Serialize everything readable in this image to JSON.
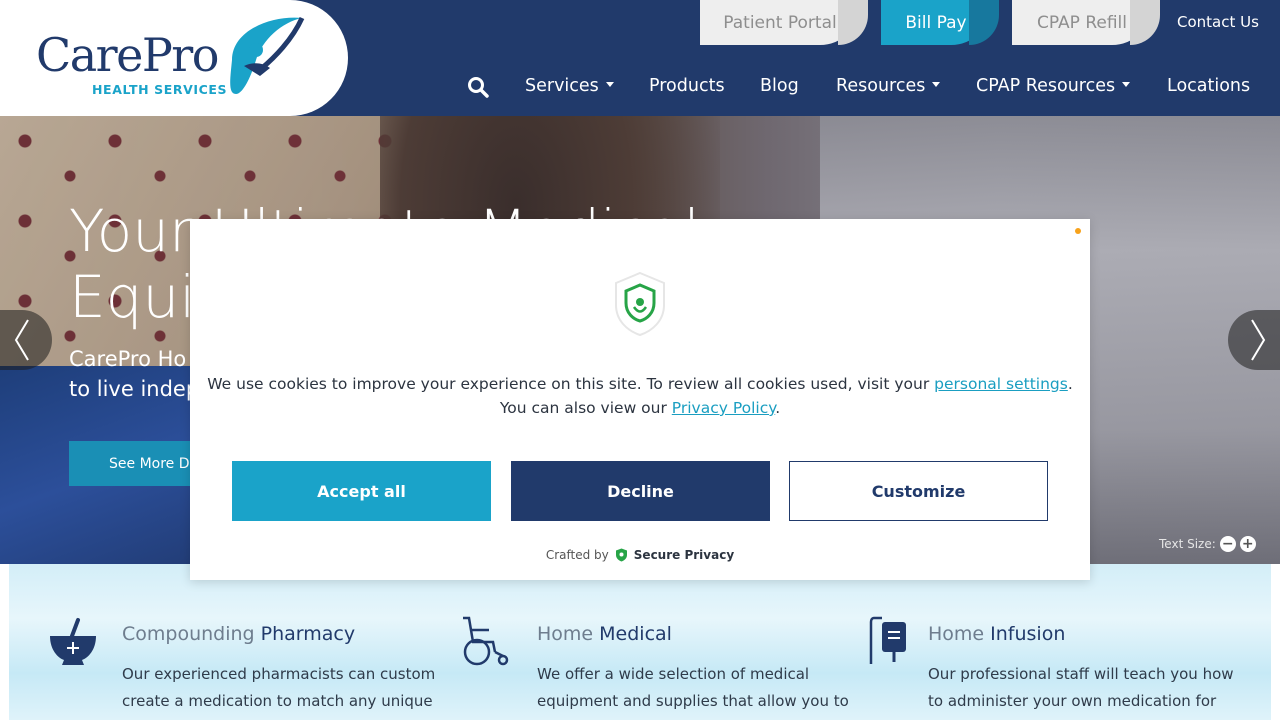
{
  "brand": {
    "name": "CarePro",
    "subtitle": "HEALTH SERVICES"
  },
  "utility_nav": {
    "patient_portal": "Patient Portal",
    "bill_pay": "Bill Pay",
    "cpap_refill": "CPAP Refill",
    "contact": "Contact Us"
  },
  "nav": {
    "items": [
      {
        "label": "Services",
        "dropdown": true
      },
      {
        "label": "Products",
        "dropdown": false
      },
      {
        "label": "Blog",
        "dropdown": false
      },
      {
        "label": "Resources",
        "dropdown": true
      },
      {
        "label": "CPAP Resources",
        "dropdown": true
      },
      {
        "label": "Locations",
        "dropdown": false
      }
    ]
  },
  "hero": {
    "title_line1": "Your Ultimate Medical",
    "title_line2": "Equi",
    "sub_line1": "CarePro Ho",
    "sub_line2": "to live indep",
    "button": "See More De",
    "text_size_label": "Text Size:"
  },
  "services": [
    {
      "light": "Compounding ",
      "bold": "Pharmacy",
      "desc": "Our experienced pharmacists can custom create a medication to match any unique",
      "icon": "mortar-pestle-icon"
    },
    {
      "light": "Home ",
      "bold": "Medical",
      "desc": "We offer a wide selection of medical equipment and supplies that allow you to",
      "icon": "wheelchair-icon"
    },
    {
      "light": "Home ",
      "bold": "Infusion",
      "desc": "Our professional staff will teach you how to administer your own medication for infusion",
      "icon": "iv-bag-icon"
    }
  ],
  "cookie": {
    "text_before": "We use cookies to improve your experience on this site. To review all cookies used, visit your ",
    "link_settings": "personal settings",
    "text_mid": ".",
    "text_line2": "You can also view our ",
    "link_policy": "Privacy Policy",
    "text_end": ".",
    "accept": "Accept all",
    "decline": "Decline",
    "customize": "Customize",
    "crafted_by": "Crafted by",
    "provider": "Secure Privacy"
  },
  "colors": {
    "navy": "#213a6b",
    "teal": "#1aa3c9",
    "accent_dot": "#f7a21b"
  }
}
